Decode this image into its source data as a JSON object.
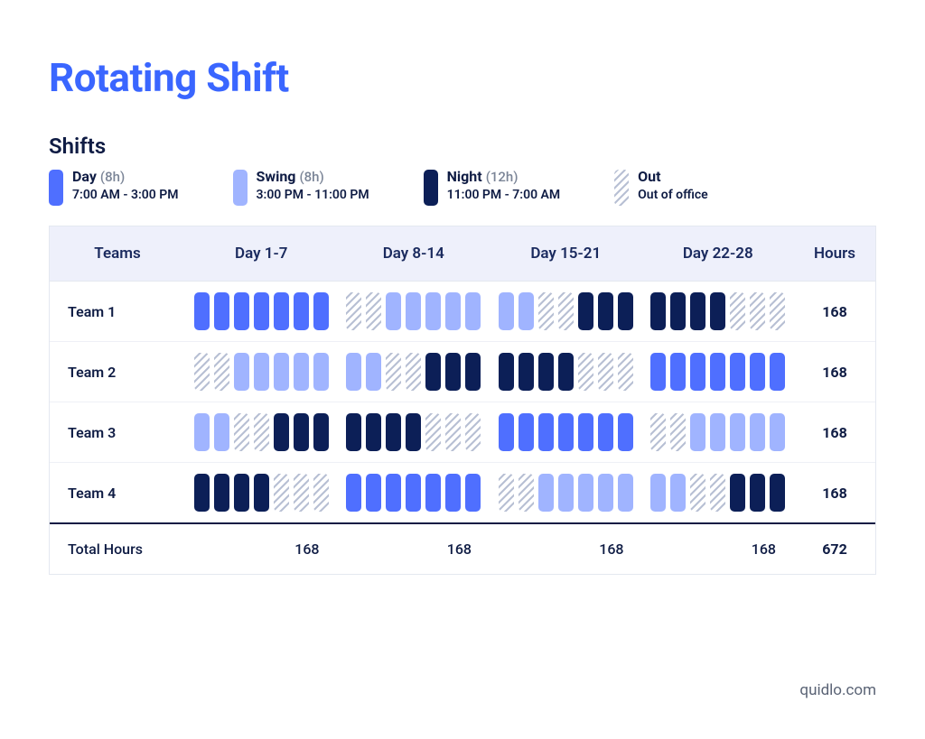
{
  "title": "Rotating Shift",
  "shifts_section_title": "Shifts",
  "legend": [
    {
      "key": "day",
      "name": "Day",
      "duration": "(8h)",
      "sub": "7:00 AM - 3:00 PM",
      "cls": "c-day"
    },
    {
      "key": "swing",
      "name": "Swing",
      "duration": "(8h)",
      "sub": "3:00 PM - 11:00 PM",
      "cls": "c-swing"
    },
    {
      "key": "night",
      "name": "Night",
      "duration": "(12h)",
      "sub": "11:00 PM - 7:00 AM",
      "cls": "c-night"
    },
    {
      "key": "out",
      "name": "Out",
      "duration": "",
      "sub": "Out of office",
      "cls": "c-out"
    }
  ],
  "color_map": {
    "day": "c-day",
    "swing": "c-swing",
    "night": "c-night",
    "out": "c-out"
  },
  "table": {
    "columns": [
      "Teams",
      "Day 1-7",
      "Day 8-14",
      "Day 15-21",
      "Day 22-28",
      "Hours"
    ],
    "teams": [
      {
        "name": "Team 1",
        "weeks": [
          [
            "day",
            "day",
            "day",
            "day",
            "day",
            "day",
            "day"
          ],
          [
            "out",
            "out",
            "swing",
            "swing",
            "swing",
            "swing",
            "swing"
          ],
          [
            "swing",
            "swing",
            "out",
            "out",
            "night",
            "night",
            "night"
          ],
          [
            "night",
            "night",
            "night",
            "night",
            "out",
            "out",
            "out"
          ]
        ],
        "hours": 168
      },
      {
        "name": "Team 2",
        "weeks": [
          [
            "out",
            "out",
            "swing",
            "swing",
            "swing",
            "swing",
            "swing"
          ],
          [
            "swing",
            "swing",
            "out",
            "out",
            "night",
            "night",
            "night"
          ],
          [
            "night",
            "night",
            "night",
            "night",
            "out",
            "out",
            "out"
          ],
          [
            "day",
            "day",
            "day",
            "day",
            "day",
            "day",
            "day"
          ]
        ],
        "hours": 168
      },
      {
        "name": "Team 3",
        "weeks": [
          [
            "swing",
            "swing",
            "out",
            "out",
            "night",
            "night",
            "night"
          ],
          [
            "night",
            "night",
            "night",
            "night",
            "out",
            "out",
            "out"
          ],
          [
            "day",
            "day",
            "day",
            "day",
            "day",
            "day",
            "day"
          ],
          [
            "out",
            "out",
            "swing",
            "swing",
            "swing",
            "swing",
            "swing"
          ]
        ],
        "hours": 168
      },
      {
        "name": "Team 4",
        "weeks": [
          [
            "night",
            "night",
            "night",
            "night",
            "out",
            "out",
            "out"
          ],
          [
            "day",
            "day",
            "day",
            "day",
            "day",
            "day",
            "day"
          ],
          [
            "out",
            "out",
            "swing",
            "swing",
            "swing",
            "swing",
            "swing"
          ],
          [
            "swing",
            "swing",
            "out",
            "out",
            "night",
            "night",
            "night"
          ]
        ],
        "hours": 168
      }
    ],
    "footer": {
      "label": "Total Hours",
      "week_totals": [
        168,
        168,
        168,
        168
      ],
      "grand_total": 672
    }
  },
  "brand": "quidlo.com",
  "chart_data": {
    "type": "table",
    "title": "Rotating Shift",
    "shift_types": {
      "day": {
        "label": "Day",
        "hours": 8,
        "time": "7:00 AM - 3:00 PM"
      },
      "swing": {
        "label": "Swing",
        "hours": 8,
        "time": "3:00 PM - 11:00 PM"
      },
      "night": {
        "label": "Night",
        "hours": 12,
        "time": "11:00 PM - 7:00 AM"
      },
      "out": {
        "label": "Out",
        "hours": 0,
        "time": "Out of office"
      }
    },
    "weeks": [
      "Day 1-7",
      "Day 8-14",
      "Day 15-21",
      "Day 22-28"
    ],
    "schedule": {
      "Team 1": [
        [
          "day",
          "day",
          "day",
          "day",
          "day",
          "day",
          "day"
        ],
        [
          "out",
          "out",
          "swing",
          "swing",
          "swing",
          "swing",
          "swing"
        ],
        [
          "swing",
          "swing",
          "out",
          "out",
          "night",
          "night",
          "night"
        ],
        [
          "night",
          "night",
          "night",
          "night",
          "out",
          "out",
          "out"
        ]
      ],
      "Team 2": [
        [
          "out",
          "out",
          "swing",
          "swing",
          "swing",
          "swing",
          "swing"
        ],
        [
          "swing",
          "swing",
          "out",
          "out",
          "night",
          "night",
          "night"
        ],
        [
          "night",
          "night",
          "night",
          "night",
          "out",
          "out",
          "out"
        ],
        [
          "day",
          "day",
          "day",
          "day",
          "day",
          "day",
          "day"
        ]
      ],
      "Team 3": [
        [
          "swing",
          "swing",
          "out",
          "out",
          "night",
          "night",
          "night"
        ],
        [
          "night",
          "night",
          "night",
          "night",
          "out",
          "out",
          "out"
        ],
        [
          "day",
          "day",
          "day",
          "day",
          "day",
          "day",
          "day"
        ],
        [
          "out",
          "out",
          "swing",
          "swing",
          "swing",
          "swing",
          "swing"
        ]
      ],
      "Team 4": [
        [
          "night",
          "night",
          "night",
          "night",
          "out",
          "out",
          "out"
        ],
        [
          "day",
          "day",
          "day",
          "day",
          "day",
          "day",
          "day"
        ],
        [
          "out",
          "out",
          "swing",
          "swing",
          "swing",
          "swing",
          "swing"
        ],
        [
          "swing",
          "swing",
          "out",
          "out",
          "night",
          "night",
          "night"
        ]
      ]
    },
    "team_hours": {
      "Team 1": 168,
      "Team 2": 168,
      "Team 3": 168,
      "Team 4": 168
    },
    "week_hours": [
      168,
      168,
      168,
      168
    ],
    "grand_total_hours": 672
  }
}
